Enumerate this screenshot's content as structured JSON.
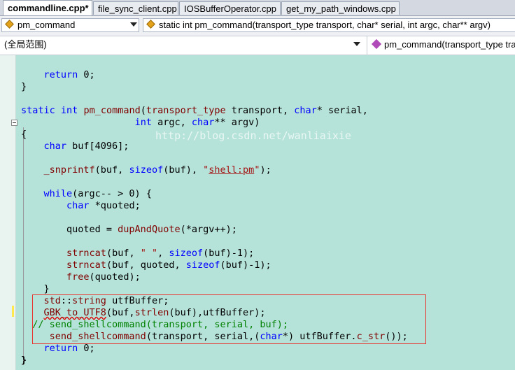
{
  "tabs": [
    {
      "label": "commandline.cpp*",
      "active": true
    },
    {
      "label": "file_sync_client.cpp",
      "active": false
    },
    {
      "label": "IOSBufferOperator.cpp",
      "active": false
    },
    {
      "label": "get_my_path_windows.cpp",
      "active": false
    }
  ],
  "nav": {
    "scope_combo": "pm_command",
    "member_combo": "static int pm_command(transport_type transport, char* serial, int argc, char** argv)"
  },
  "scopebar": {
    "left": "(全局范围)",
    "right": "pm_command(transport_type tra"
  },
  "code": {
    "l1": [
      "    ",
      "return",
      " 0;"
    ],
    "l2": "}",
    "l3": [
      "static",
      " ",
      "int",
      " ",
      "pm_command",
      "(",
      "transport_type",
      " transport, ",
      "char",
      "* serial,"
    ],
    "l4": [
      "                    ",
      "int",
      " argc, ",
      "char",
      "** argv)"
    ],
    "l5": "{",
    "l6": [
      "    ",
      "char",
      " buf[4096];"
    ],
    "l7": [
      "    ",
      "_snprintf",
      "(buf, ",
      "sizeof",
      "(buf), ",
      "\"",
      "shell:pm",
      "\"",
      ");"
    ],
    "l8": [
      "    ",
      "while",
      "(argc-- > 0) {"
    ],
    "l9": [
      "        ",
      "char",
      " *quoted;"
    ],
    "l10": [
      "        quoted = ",
      "dupAndQuote",
      "(*argv++);"
    ],
    "l11": [
      "        ",
      "strncat",
      "(buf, ",
      "\" \"",
      ", ",
      "sizeof",
      "(buf)-1);"
    ],
    "l12": [
      "        ",
      "strncat",
      "(buf, quoted, ",
      "sizeof",
      "(buf)-1);"
    ],
    "l13": [
      "        ",
      "free",
      "(quoted);"
    ],
    "l14": "    }",
    "l15": [
      "    ",
      "std",
      "::",
      "string",
      " utfBuffer;"
    ],
    "l16": [
      "    ",
      "GBK_to_UTF8",
      "(buf,",
      "strlen",
      "(buf),utfBuffer);"
    ],
    "l17": "  // send_shellcommand(transport, serial, buf);",
    "l18": [
      "     ",
      "send_shellcommand",
      "(transport, serial,(",
      "char",
      "*) utfBuffer.",
      "c_str",
      "());"
    ],
    "l19": [
      "    ",
      "return",
      " 0;"
    ],
    "l20": "}"
  },
  "watermark": "http://blog.csdn.net/wanliaixie",
  "colors": {
    "editor_bg": "#b6e3d9",
    "keyword": "#0000ff",
    "function": "#800000",
    "string": "#a31515",
    "comment": "#008000",
    "highlight_box": "#e8322b"
  }
}
